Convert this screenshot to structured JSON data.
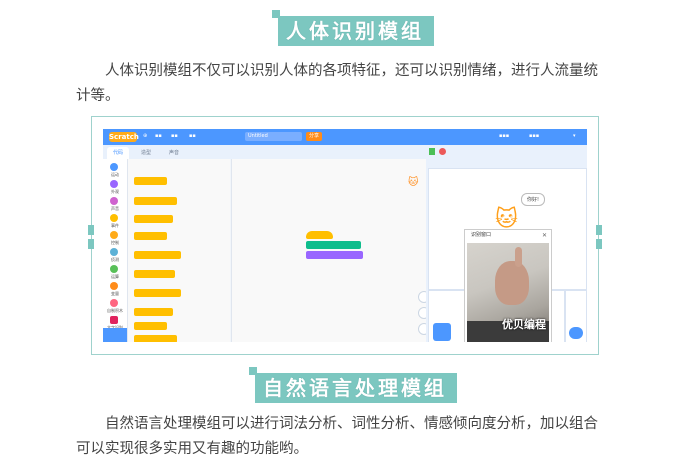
{
  "section1": {
    "title": "人体识别模组",
    "paragraph": "人体识别模组不仅可以识别人体的各项特征，还可以识别情绪，进行人流量统计等。"
  },
  "screenshot": {
    "logo": "Scratch",
    "project_title": "Untitled",
    "share_label": "分享",
    "tabs": [
      "代码",
      "造型",
      "声音"
    ],
    "categories": [
      "运动",
      "外观",
      "声音",
      "事件",
      "控制",
      "侦测",
      "运算",
      "变量",
      "自制积木",
      "文字识别"
    ],
    "cam_window_title": "识别窗口",
    "speech_bubble": "你好!",
    "watermark": "优贝编程",
    "colors": {
      "menubar": "#4c97ff",
      "accent": "#7cc7c0"
    }
  },
  "section2": {
    "title": "自然语言处理模组",
    "paragraph": "自然语言处理模组可以进行词法分析、词性分析、情感倾向度分析，加以组合可以实现很多实用又有趣的功能哟。"
  }
}
